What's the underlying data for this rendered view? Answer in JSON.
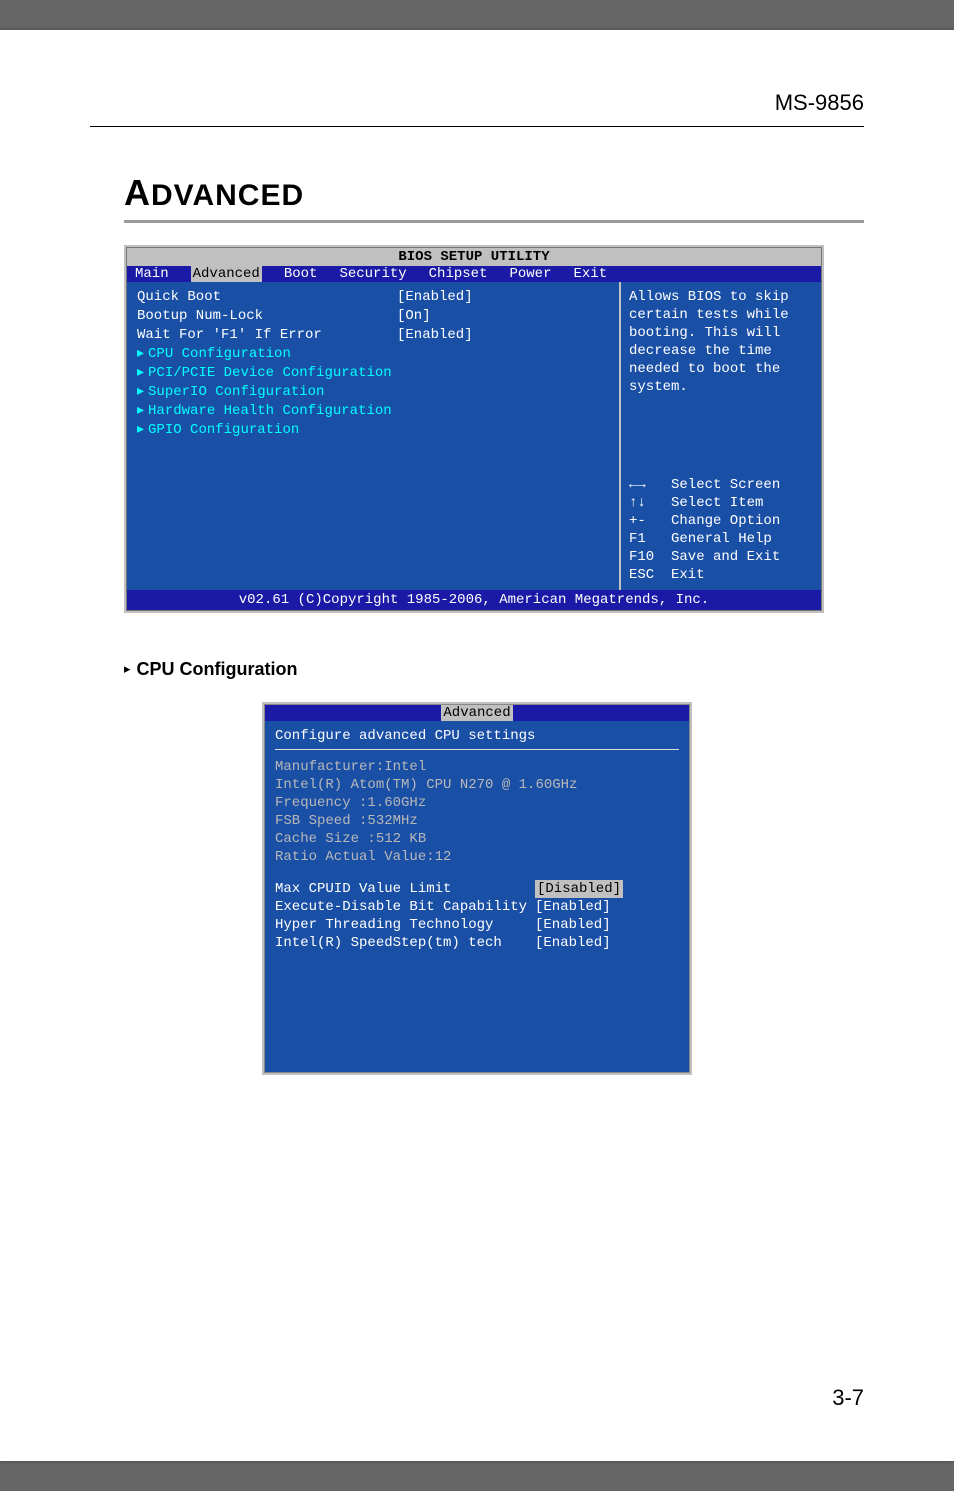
{
  "document": {
    "header": "MS-9856",
    "pageNumber": "3-7",
    "section": {
      "first": "A",
      "rest": "DVANCED"
    },
    "subheading": "CPU Configuration"
  },
  "bios": {
    "title": "BIOS SETUP UTILITY",
    "tabs": [
      "Main",
      "Advanced",
      "Boot",
      "Security",
      "Chipset",
      "Power",
      "Exit"
    ],
    "items": [
      {
        "label": "Quick Boot",
        "value": "[Enabled]",
        "type": "opt"
      },
      {
        "label": "Bootup Num-Lock",
        "value": "[On]",
        "type": "opt"
      },
      {
        "label": "Wait For 'F1' If Error",
        "value": "[Enabled]",
        "type": "opt"
      },
      {
        "label": "CPU Configuration",
        "type": "sub"
      },
      {
        "label": "PCI/PCIE Device Configuration",
        "type": "sub"
      },
      {
        "label": "SuperIO Configuration",
        "type": "sub"
      },
      {
        "label": "Hardware Health Configuration",
        "type": "sub"
      },
      {
        "label": "GPIO Configuration",
        "type": "sub"
      }
    ],
    "help": "Allows BIOS to skip certain tests while booting. This will decrease the time needed to boot the system.",
    "keys": [
      {
        "k": "←→",
        "d": "Select Screen"
      },
      {
        "k": "↑↓",
        "d": "Select Item"
      },
      {
        "k": "+-",
        "d": "Change Option"
      },
      {
        "k": "F1",
        "d": "General Help"
      },
      {
        "k": "F10",
        "d": "Save and Exit"
      },
      {
        "k": "ESC",
        "d": "Exit"
      }
    ],
    "footer": "v02.61 (C)Copyright 1985-2006, American Megatrends, Inc."
  },
  "advanced": {
    "tab": "Advanced",
    "title": "Configure advanced CPU settings",
    "info": [
      "Manufacturer:Intel",
      "Intel(R) Atom(TM) CPU N270   @ 1.60GHz",
      "Frequency   :1.60GHz",
      "FSB Speed   :532MHz",
      "Cache Size  :512 KB",
      "Ratio Actual Value:12"
    ],
    "opts": [
      {
        "label": "Max CPUID Value Limit",
        "value": "[Disabled]",
        "sel": true
      },
      {
        "label": "Execute-Disable Bit Capability",
        "value": "[Enabled]"
      },
      {
        "label": "Hyper Threading Technology",
        "value": "[Enabled]"
      },
      {
        "label": "Intel(R) SpeedStep(tm) tech",
        "value": "[Enabled]"
      }
    ]
  }
}
